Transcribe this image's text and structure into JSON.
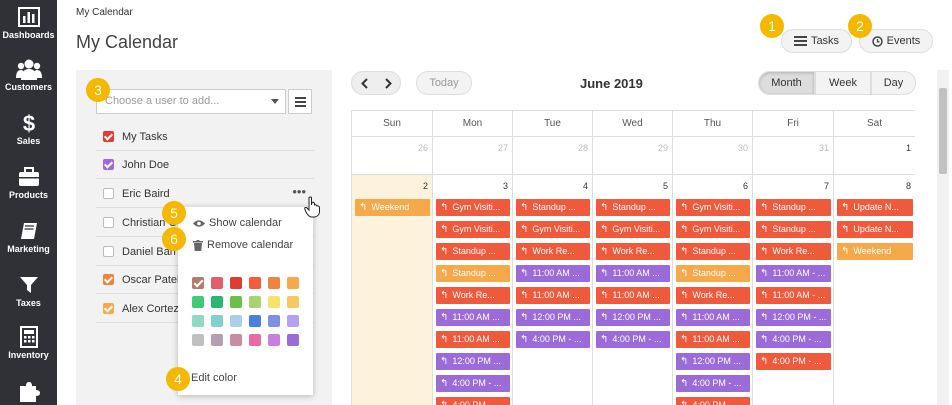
{
  "nav": [
    {
      "label": "Dashboards",
      "icon": "bar-chart-icon"
    },
    {
      "label": "Customers",
      "icon": "users-icon"
    },
    {
      "label": "Sales",
      "icon": "dollar-icon"
    },
    {
      "label": "Products",
      "icon": "briefcase-icon"
    },
    {
      "label": "Marketing",
      "icon": "book-icon"
    },
    {
      "label": "Taxes",
      "icon": "filter-icon"
    },
    {
      "label": "Inventory",
      "icon": "calculator-icon"
    },
    {
      "label": "",
      "icon": "puzzle-icon"
    }
  ],
  "header": {
    "breadcrumb": "My Calendar",
    "title": "My Calendar",
    "tasks_label": "Tasks",
    "events_label": "Events"
  },
  "badges": [
    "1",
    "2",
    "3",
    "4",
    "5",
    "6"
  ],
  "panel": {
    "user_placeholder": "Choose a user to add...",
    "users": [
      {
        "name": "My Tasks",
        "checked": true,
        "color": "#e03c31"
      },
      {
        "name": "John Doe",
        "checked": true,
        "color": "#9b6cd9"
      },
      {
        "name": "Eric Baird",
        "checked": false,
        "color": ""
      },
      {
        "name": "Christian G",
        "checked": false,
        "color": ""
      },
      {
        "name": "Daniel Barr",
        "checked": false,
        "color": ""
      },
      {
        "name": "Oscar Patel",
        "checked": true,
        "color": "#f0843c"
      },
      {
        "name": "Alex Cortez",
        "checked": true,
        "color": "#f5a94a"
      }
    ],
    "more_label": "•••"
  },
  "popup": {
    "show_calendar": "Show calendar",
    "remove_calendar": "Remove calendar",
    "edit_color": "Edit color",
    "selected_swatch": "#b57a6e",
    "swatches": [
      "#b57a6e",
      "#e35d6a",
      "#e03c31",
      "#f55c3a",
      "#f0843c",
      "#f5a94a",
      "#45c87a",
      "#2bb673",
      "#6cc04a",
      "#a7d46f",
      "#f5e26b",
      "#f6c85f",
      "#8ed9c2",
      "#7fd1cf",
      "#a9d0e5",
      "#4a7fe0",
      "#7f8fe8",
      "#b4a2f0",
      "#c0c0c0",
      "#b0a0b0",
      "#c48fa0",
      "#e86ba7",
      "#c77fe0",
      "#9b6cd9"
    ]
  },
  "calendar": {
    "today_label": "Today",
    "month_title": "June 2019",
    "views": [
      "Month",
      "Week",
      "Day"
    ],
    "active_view": "Month",
    "days_of_week": [
      "Sun",
      "Mon",
      "Tue",
      "Wed",
      "Thu",
      "Fri",
      "Sat"
    ],
    "prev_row": [
      "26",
      "27",
      "28",
      "29",
      "30",
      "31",
      "1"
    ],
    "week_row": [
      "2",
      "3",
      "4",
      "5",
      "6",
      "7",
      "8"
    ],
    "colors": {
      "red": "#ef5a3c",
      "purple": "#9b6cd9",
      "orange": "#f5a94a"
    },
    "events": [
      [
        {
          "label": "Weekend",
          "color": "orange"
        }
      ],
      [
        {
          "label": "Gym Visiti...",
          "color": "red"
        },
        {
          "label": "Gym Visiti...",
          "color": "red"
        },
        {
          "label": "Standup ...",
          "color": "red"
        },
        {
          "label": "Standup ...",
          "color": "orange"
        },
        {
          "label": "Work Re...",
          "color": "red"
        },
        {
          "label": "11:00 AM ...",
          "color": "purple"
        },
        {
          "label": "11:00 AM ...",
          "color": "red"
        },
        {
          "label": "12:00 PM ...",
          "color": "purple"
        },
        {
          "label": "4:00 PM - ...",
          "color": "purple"
        },
        {
          "label": "4:00 PM - ...",
          "color": "red"
        }
      ],
      [
        {
          "label": "Standup ...",
          "color": "red"
        },
        {
          "label": "Gym Visiti...",
          "color": "red"
        },
        {
          "label": "Work Re...",
          "color": "red"
        },
        {
          "label": "11:00 AM ...",
          "color": "purple"
        },
        {
          "label": "11:00 AM ...",
          "color": "red"
        },
        {
          "label": "12:00 PM ...",
          "color": "purple"
        },
        {
          "label": "4:00 PM - ...",
          "color": "purple"
        }
      ],
      [
        {
          "label": "Standup ...",
          "color": "red"
        },
        {
          "label": "Gym Visiti...",
          "color": "red"
        },
        {
          "label": "Work Re...",
          "color": "red"
        },
        {
          "label": "11:00 AM ...",
          "color": "purple"
        },
        {
          "label": "11:00 AM ...",
          "color": "red"
        },
        {
          "label": "12:00 PM ...",
          "color": "purple"
        },
        {
          "label": "4:00 PM - ...",
          "color": "purple"
        }
      ],
      [
        {
          "label": "Gym Visiti...",
          "color": "red"
        },
        {
          "label": "Gym Visiti...",
          "color": "red"
        },
        {
          "label": "Standup ...",
          "color": "red"
        },
        {
          "label": "Standup ...",
          "color": "orange"
        },
        {
          "label": "Work Re...",
          "color": "red"
        },
        {
          "label": "11:00 AM ...",
          "color": "purple"
        },
        {
          "label": "11:00 AM ...",
          "color": "red"
        },
        {
          "label": "12:00 PM ...",
          "color": "purple"
        },
        {
          "label": "4:00 PM - ...",
          "color": "purple"
        },
        {
          "label": "4:00 PM - ...",
          "color": "red"
        }
      ],
      [
        {
          "label": "Standup ...",
          "color": "red"
        },
        {
          "label": "Standup ...",
          "color": "red"
        },
        {
          "label": "Work Re...",
          "color": "red"
        },
        {
          "label": "11:00 AM - ...",
          "color": "purple"
        },
        {
          "label": "11:00 AM - ...",
          "color": "red"
        },
        {
          "label": "12:00 PM - ...",
          "color": "purple"
        },
        {
          "label": "4:00 PM - ...",
          "color": "purple"
        },
        {
          "label": "4:00 PM - ...",
          "color": "red"
        }
      ],
      [
        {
          "label": "Update N...",
          "color": "red"
        },
        {
          "label": "Update N...",
          "color": "red"
        },
        {
          "label": "Weekend",
          "color": "orange"
        }
      ]
    ]
  }
}
